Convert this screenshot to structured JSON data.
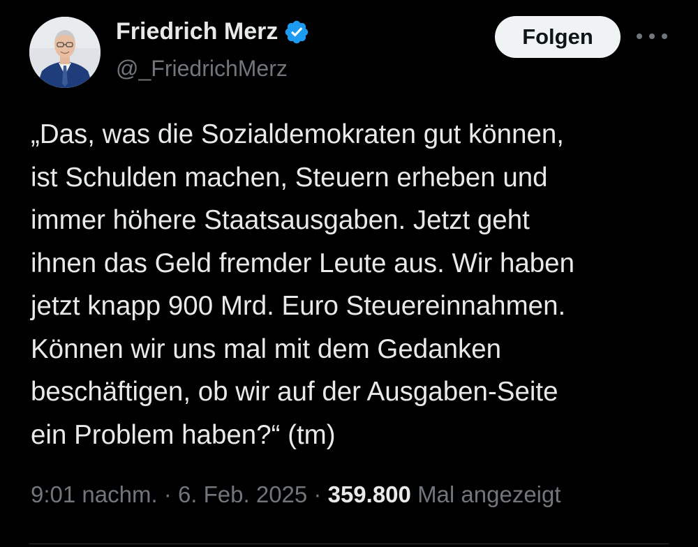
{
  "author": {
    "name": "Friedrich Merz",
    "handle": "@_FriedrichMerz",
    "verified": true,
    "avatar_icon": "person-portrait-avatar",
    "verified_icon": "verified-badge-icon"
  },
  "actions": {
    "follow_label": "Folgen",
    "more_icon": "more-options-icon"
  },
  "tweet": {
    "text": "„Das, was die Sozialdemokraten gut können,\nist Schulden machen, Steuern erheben und\nimmer höhere Staatsausgaben. Jetzt geht\nihnen das Geld fremder Leute aus. Wir haben\njetzt knapp 900 Mrd. Euro Steuereinnahmen.\nKönnen wir uns mal mit dem Gedanken\nbeschäftigen, ob wir auf der Ausgaben-Seite\nein Problem haben?“ (tm)",
    "time": "9:01 nachm.",
    "separator": " · ",
    "date": "6. Feb. 2025",
    "views_count": "359.800",
    "views_label": "Mal angezeigt"
  },
  "colors": {
    "background": "#000000",
    "text_primary": "#e7e9ea",
    "text_secondary": "#71767b",
    "verified_blue": "#1d9bf0",
    "follow_button_bg": "#eff3f4",
    "divider": "#2f3336"
  }
}
